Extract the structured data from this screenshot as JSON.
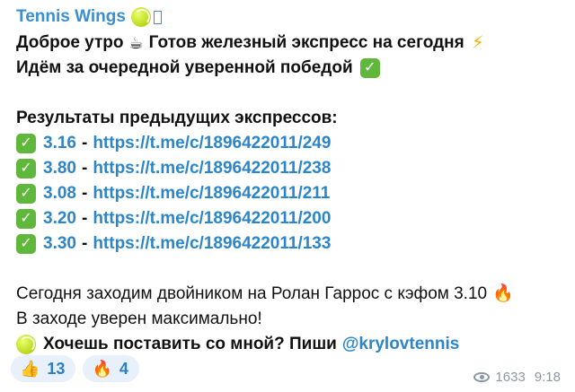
{
  "message": {
    "author": "Tennis Wings",
    "line1": "Доброе утро",
    "line1b": "Готов железный экспресс на сегодня",
    "line2": "Идём за очередной уверенной победой",
    "results_title": "Результаты предыдущих экспрессов:",
    "results": [
      {
        "odds": "3.16",
        "link": "https://t.me/c/1896422011/249"
      },
      {
        "odds": "3.80",
        "link": "https://t.me/c/1896422011/238"
      },
      {
        "odds": "3.08",
        "link": "https://t.me/c/1896422011/211"
      },
      {
        "odds": "3.20",
        "link": "https://t.me/c/1896422011/200"
      },
      {
        "odds": "3.30",
        "link": "https://t.me/c/1896422011/133"
      }
    ],
    "today_line": "Сегодня заходим двойником на Ролан Гаррос с кэфом 3.10",
    "confidence_line": "В заходе уверен максимально!",
    "cta": "Хочешь поставить со мной? Пиши",
    "mention": "@krylovtennis"
  },
  "reactions": [
    {
      "emoji": "👍",
      "count": "13"
    },
    {
      "emoji": "🔥",
      "count": "4"
    }
  ],
  "meta": {
    "views": "1633",
    "time": "9:18"
  },
  "icons": [
    "tennis-ball-icon",
    "coffee-icon",
    "lightning-icon",
    "check-icon",
    "fire-icon",
    "eye-icon"
  ],
  "colors": {
    "link": "#2b86c9",
    "author": "#3a8fd0",
    "check": "#5fb83b",
    "reaction_bg": "#e8f1fb"
  }
}
